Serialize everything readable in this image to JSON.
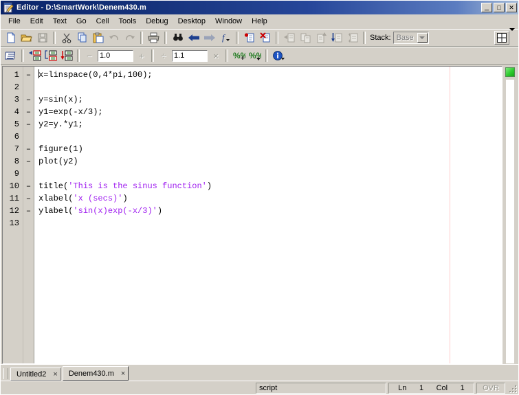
{
  "window": {
    "title": "Editor - D:\\SmartWork\\Denem430.m",
    "icon": "editor-document-pencil-icon",
    "minimize_label": "_",
    "maximize_label": "□",
    "close_label": "✕"
  },
  "menubar": {
    "items": [
      {
        "label": "File"
      },
      {
        "label": "Edit"
      },
      {
        "label": "Text"
      },
      {
        "label": "Go"
      },
      {
        "label": "Cell"
      },
      {
        "label": "Tools"
      },
      {
        "label": "Debug"
      },
      {
        "label": "Desktop"
      },
      {
        "label": "Window"
      },
      {
        "label": "Help"
      }
    ]
  },
  "toolbar_main": {
    "buttons": [
      {
        "name": "new-file-icon",
        "tooltip": "New"
      },
      {
        "name": "open-file-icon",
        "tooltip": "Open"
      },
      {
        "name": "save-icon",
        "tooltip": "Save",
        "disabled": true
      },
      {
        "name": "cut-icon",
        "tooltip": "Cut"
      },
      {
        "name": "copy-icon",
        "tooltip": "Copy"
      },
      {
        "name": "paste-icon",
        "tooltip": "Paste"
      },
      {
        "name": "undo-icon",
        "tooltip": "Undo",
        "disabled": true
      },
      {
        "name": "redo-icon",
        "tooltip": "Redo",
        "disabled": true
      },
      {
        "name": "print-icon",
        "tooltip": "Print"
      },
      {
        "name": "find-icon",
        "tooltip": "Find"
      },
      {
        "name": "back-arrow-icon",
        "tooltip": "Back"
      },
      {
        "name": "forward-arrow-icon",
        "tooltip": "Forward"
      },
      {
        "name": "function-browser-icon",
        "tooltip": "Function"
      },
      {
        "name": "set-breakpoint-icon",
        "tooltip": "Set/Clear Breakpoint"
      },
      {
        "name": "clear-breakpoints-icon",
        "tooltip": "Clear All Breakpoints"
      },
      {
        "name": "step-icon",
        "tooltip": "Step",
        "disabled": true
      },
      {
        "name": "step-in-icon",
        "tooltip": "Step In",
        "disabled": true
      },
      {
        "name": "step-out-icon",
        "tooltip": "Step Out",
        "disabled": true
      },
      {
        "name": "continue-icon",
        "tooltip": "Continue",
        "disabled": true
      },
      {
        "name": "exit-debug-icon",
        "tooltip": "Exit Debug Mode",
        "disabled": true
      }
    ],
    "stack_label": "Stack:",
    "stack_value": "Base",
    "layout_icon": "window-layout-icon"
  },
  "toolbar_cell": {
    "buttons": [
      {
        "name": "cell-mode-icon",
        "tooltip": "Enable Cell Mode"
      },
      {
        "name": "insert-cell-divider-icon",
        "tooltip": "Insert Cell Divider"
      },
      {
        "name": "insert-cell-divider-selection-icon",
        "tooltip": "Insert Cell Divider Around Selection"
      },
      {
        "name": "evaluate-current-cell-icon",
        "tooltip": "Evaluate Current Cell"
      },
      {
        "name": "decrement-icon",
        "tooltip": "Decrement",
        "disabled": true
      },
      {
        "name": "increment-icon",
        "tooltip": "Increment",
        "disabled": true
      },
      {
        "name": "divide-icon",
        "tooltip": "Divide",
        "disabled": true
      },
      {
        "name": "multiply-icon",
        "tooltip": "Multiply",
        "disabled": true
      },
      {
        "name": "evaluate-cell-advance-icon",
        "tooltip": "Evaluate Cell and Advance"
      },
      {
        "name": "evaluate-entire-file-icon",
        "tooltip": "Evaluate Entire File"
      },
      {
        "name": "info-icon",
        "tooltip": "Cell Mode Help"
      }
    ],
    "add_value": "1.0",
    "divide_value": "1.1"
  },
  "editor": {
    "mlint_status": "ok",
    "mlint_color": "#2ecc2e",
    "string_color": "#a020f0",
    "lines": [
      {
        "num": "1",
        "mark": "–",
        "segments": [
          {
            "t": "x=linspace(0,4*pi,100);",
            "s": "code"
          }
        ]
      },
      {
        "num": "2",
        "mark": "",
        "segments": []
      },
      {
        "num": "3",
        "mark": "–",
        "segments": [
          {
            "t": "y=sin(x);",
            "s": "code"
          }
        ]
      },
      {
        "num": "4",
        "mark": "–",
        "segments": [
          {
            "t": "y1=exp(-x/3);",
            "s": "code"
          }
        ]
      },
      {
        "num": "5",
        "mark": "–",
        "segments": [
          {
            "t": "y2=y.*y1;",
            "s": "code"
          }
        ]
      },
      {
        "num": "6",
        "mark": "",
        "segments": []
      },
      {
        "num": "7",
        "mark": "–",
        "segments": [
          {
            "t": "figure(1)",
            "s": "code"
          }
        ]
      },
      {
        "num": "8",
        "mark": "–",
        "segments": [
          {
            "t": "plot(y2)",
            "s": "code"
          }
        ]
      },
      {
        "num": "9",
        "mark": "",
        "segments": []
      },
      {
        "num": "10",
        "mark": "–",
        "segments": [
          {
            "t": "title(",
            "s": "code"
          },
          {
            "t": "'This is the sinus function'",
            "s": "str"
          },
          {
            "t": ")",
            "s": "code"
          }
        ]
      },
      {
        "num": "11",
        "mark": "–",
        "segments": [
          {
            "t": "xlabel(",
            "s": "code"
          },
          {
            "t": "'x (secs)'",
            "s": "str"
          },
          {
            "t": ")",
            "s": "code"
          }
        ]
      },
      {
        "num": "12",
        "mark": "–",
        "segments": [
          {
            "t": "ylabel(",
            "s": "code"
          },
          {
            "t": "'sin(x)exp(-x/3)'",
            "s": "str"
          },
          {
            "t": ")",
            "s": "code"
          }
        ]
      },
      {
        "num": "13",
        "mark": "",
        "segments": []
      }
    ]
  },
  "tabs": [
    {
      "label": "Untitled2",
      "close": "×",
      "active": false
    },
    {
      "label": "Denem430.m",
      "close": "×",
      "active": true
    }
  ],
  "statusbar": {
    "file_type": "script",
    "line_label": "Ln",
    "line_value": "1",
    "col_label": "Col",
    "col_value": "1",
    "overwrite_label": "OVR"
  }
}
